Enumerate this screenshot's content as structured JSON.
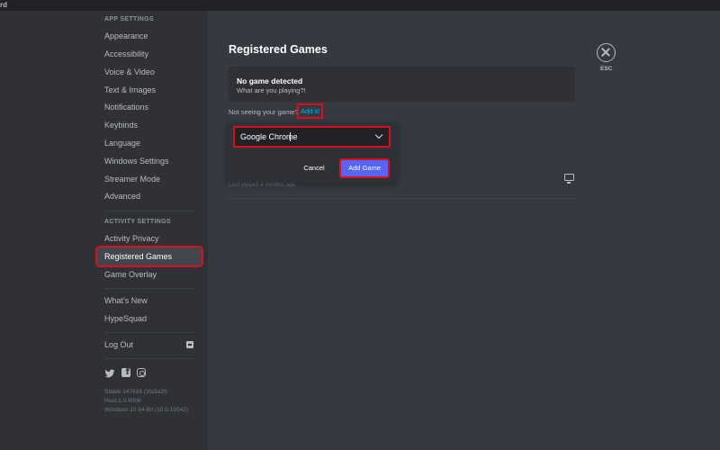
{
  "window": {
    "title_fragment": "rd"
  },
  "sidebar": {
    "app_settings_header": "APP SETTINGS",
    "app_settings_items": [
      {
        "label": "Appearance"
      },
      {
        "label": "Accessibility"
      },
      {
        "label": "Voice & Video"
      },
      {
        "label": "Text & Images"
      },
      {
        "label": "Notifications"
      },
      {
        "label": "Keybinds"
      },
      {
        "label": "Language"
      },
      {
        "label": "Windows Settings"
      },
      {
        "label": "Streamer Mode"
      },
      {
        "label": "Advanced"
      }
    ],
    "activity_settings_header": "ACTIVITY SETTINGS",
    "activity_items": [
      {
        "label": "Activity Privacy"
      },
      {
        "label": "Registered Games",
        "active": true,
        "highlighted": true
      },
      {
        "label": "Game Overlay"
      }
    ],
    "misc_items": [
      {
        "label": "What's New"
      },
      {
        "label": "HypeSquad"
      }
    ],
    "logout_label": "Log Out",
    "social_icons": [
      "twitter-icon",
      "facebook-icon",
      "instagram-icon"
    ],
    "version_lines": [
      "Stable 147616 (3fa3a2f)",
      "Host 1.0.9006",
      "Windows 10 64-Bit (10.0.19042)"
    ]
  },
  "main": {
    "title": "Registered Games",
    "no_game": {
      "title": "No game detected",
      "subtitle": "What are you playing?!"
    },
    "not_seeing_text": "Not seeing your game?",
    "add_it_link": "Add it!",
    "add_game_popout": {
      "selected_game": "Google Chrome",
      "cancel_label": "Cancel",
      "add_label": "Add Game"
    },
    "last_played": "Last played 4 months ago",
    "esc_label": "ESC"
  },
  "colors": {
    "sidebar_bg": "#2f3136",
    "content_bg": "#36393f",
    "accent": "#5865f2",
    "link": "#00b0f4",
    "highlight_outline": "#d80f1f"
  }
}
